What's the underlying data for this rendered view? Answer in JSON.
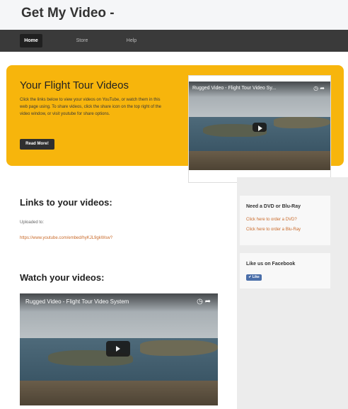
{
  "header": {
    "site_title": "Get My Video -"
  },
  "nav": {
    "items": [
      {
        "label": "Home"
      },
      {
        "label": "Store"
      },
      {
        "label": "Help"
      }
    ]
  },
  "hero": {
    "title": "Your Flight Tour Videos",
    "text": "Click the links below to view your videos on YouTube, or watch them in this web page using. To share videos, click the share icon on the top right of the video window, or visit youtube for share options.",
    "button_label": "Read More!",
    "video_title": "Rugged Video - Flight Tour Video Sy..."
  },
  "links_section": {
    "title": "Links to your videos:",
    "uploaded": "Uploaded to:",
    "video_link": "https://www.youtube.com/embed/hyKJL9gkWsw?"
  },
  "watch_section": {
    "title": "Watch your videos:",
    "video_title": "Rugged Video - Flight Tour Video System"
  },
  "sidebar": {
    "dvd": {
      "title": "Need a DVD or Blu-Ray",
      "link1": "Click here to order a DVD?",
      "link2": "Click here to order a Blu-Ray"
    },
    "facebook": {
      "title": "Like us on Facebook",
      "like_label": "Like"
    }
  },
  "icons": [
    "clock-icon",
    "share-icon",
    "play-icon",
    "facebook-like-icon"
  ],
  "colors": {
    "hero_bg": "#f7b50c",
    "navbar_bg": "#3a3a3a",
    "link": "#c96a2a",
    "button_bg": "#2f2f2f"
  }
}
